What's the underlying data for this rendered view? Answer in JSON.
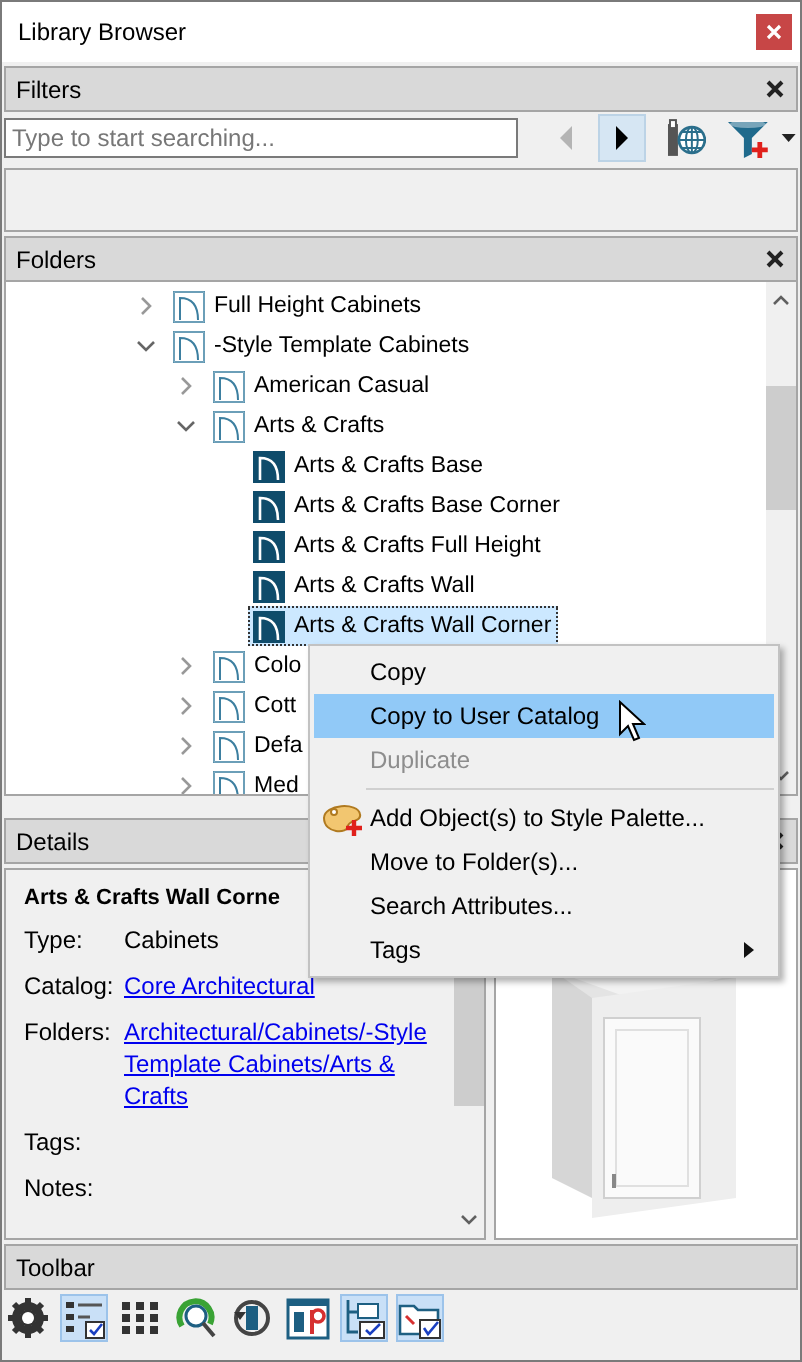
{
  "window": {
    "title": "Library Browser"
  },
  "filters": {
    "title": "Filters",
    "search": {
      "placeholder": "Type to start searching..."
    },
    "nav_buttons": [
      {
        "kind": "back",
        "disabled": true,
        "selected": false
      },
      {
        "kind": "forward",
        "disabled": false,
        "selected": true
      }
    ]
  },
  "folders": {
    "title": "Folders",
    "tree": [
      {
        "label": "Full Height Cabinets",
        "kind": "folder",
        "expanded": false,
        "selected": false
      },
      {
        "label": "-Style Template Cabinets",
        "kind": "folder",
        "expanded": true,
        "selected": false,
        "children": [
          {
            "label": "American Casual",
            "kind": "folder",
            "expanded": false,
            "selected": false
          },
          {
            "label": "Arts & Crafts",
            "kind": "folder",
            "expanded": true,
            "selected": false,
            "children": [
              {
                "label": "Arts & Crafts Base",
                "kind": "item",
                "selected": false
              },
              {
                "label": "Arts & Crafts Base Corner",
                "kind": "item",
                "selected": false
              },
              {
                "label": "Arts & Crafts Full Height",
                "kind": "item",
                "selected": false
              },
              {
                "label": "Arts & Crafts Wall",
                "kind": "item",
                "selected": false
              },
              {
                "label": "Arts & Crafts Wall Corner",
                "kind": "item",
                "selected": true
              }
            ]
          },
          {
            "label": "Colo",
            "kind": "folder",
            "expanded": false,
            "selected": false
          },
          {
            "label": "Cott",
            "kind": "folder",
            "expanded": false,
            "selected": false
          },
          {
            "label": "Defa",
            "kind": "folder",
            "expanded": false,
            "selected": false
          },
          {
            "label": "Med",
            "kind": "folder",
            "expanded": false,
            "selected": false
          }
        ]
      }
    ]
  },
  "context_menu": [
    {
      "label": "Copy",
      "kind": "command",
      "disabled": false,
      "selected": false,
      "separator_before": false
    },
    {
      "label": "Copy to User Catalog",
      "kind": "command",
      "disabled": false,
      "selected": true,
      "separator_before": false
    },
    {
      "label": "Duplicate",
      "kind": "command",
      "disabled": true,
      "selected": false,
      "separator_before": false
    },
    {
      "label": "Add Object(s) to Style Palette...",
      "kind": "palette",
      "disabled": false,
      "selected": false,
      "separator_before": true
    },
    {
      "label": "Move to Folder(s)...",
      "kind": "command",
      "disabled": false,
      "selected": false,
      "separator_before": false
    },
    {
      "label": "Search Attributes...",
      "kind": "command",
      "disabled": false,
      "selected": false,
      "separator_before": false
    },
    {
      "label": "Tags",
      "kind": "submenu",
      "disabled": false,
      "selected": false,
      "separator_before": false
    }
  ],
  "details": {
    "title": "Details",
    "name": "Arts & Crafts Wall Corne",
    "fields": [
      {
        "label": "Type:",
        "value": "Cabinets",
        "kind": "text"
      },
      {
        "label": "Catalog:",
        "value": "Core Architectural",
        "kind": "link"
      },
      {
        "label": "Folders:",
        "value": "Architectural/Cabinets/-Style Template Cabinets/Arts & Crafts",
        "kind": "link"
      },
      {
        "label": "Tags:"
      },
      {
        "label": "Notes:"
      }
    ]
  },
  "toolbar": {
    "title": "Toolbar",
    "tools": [
      {
        "kind": "settings",
        "selected": false
      },
      {
        "kind": "list",
        "selected": true
      },
      {
        "kind": "grid",
        "selected": false
      },
      {
        "kind": "search",
        "selected": false
      },
      {
        "kind": "rotate",
        "selected": false
      },
      {
        "kind": "panel",
        "selected": false
      },
      {
        "kind": "tree",
        "selected": true
      },
      {
        "kind": "folder",
        "selected": true
      }
    ]
  }
}
